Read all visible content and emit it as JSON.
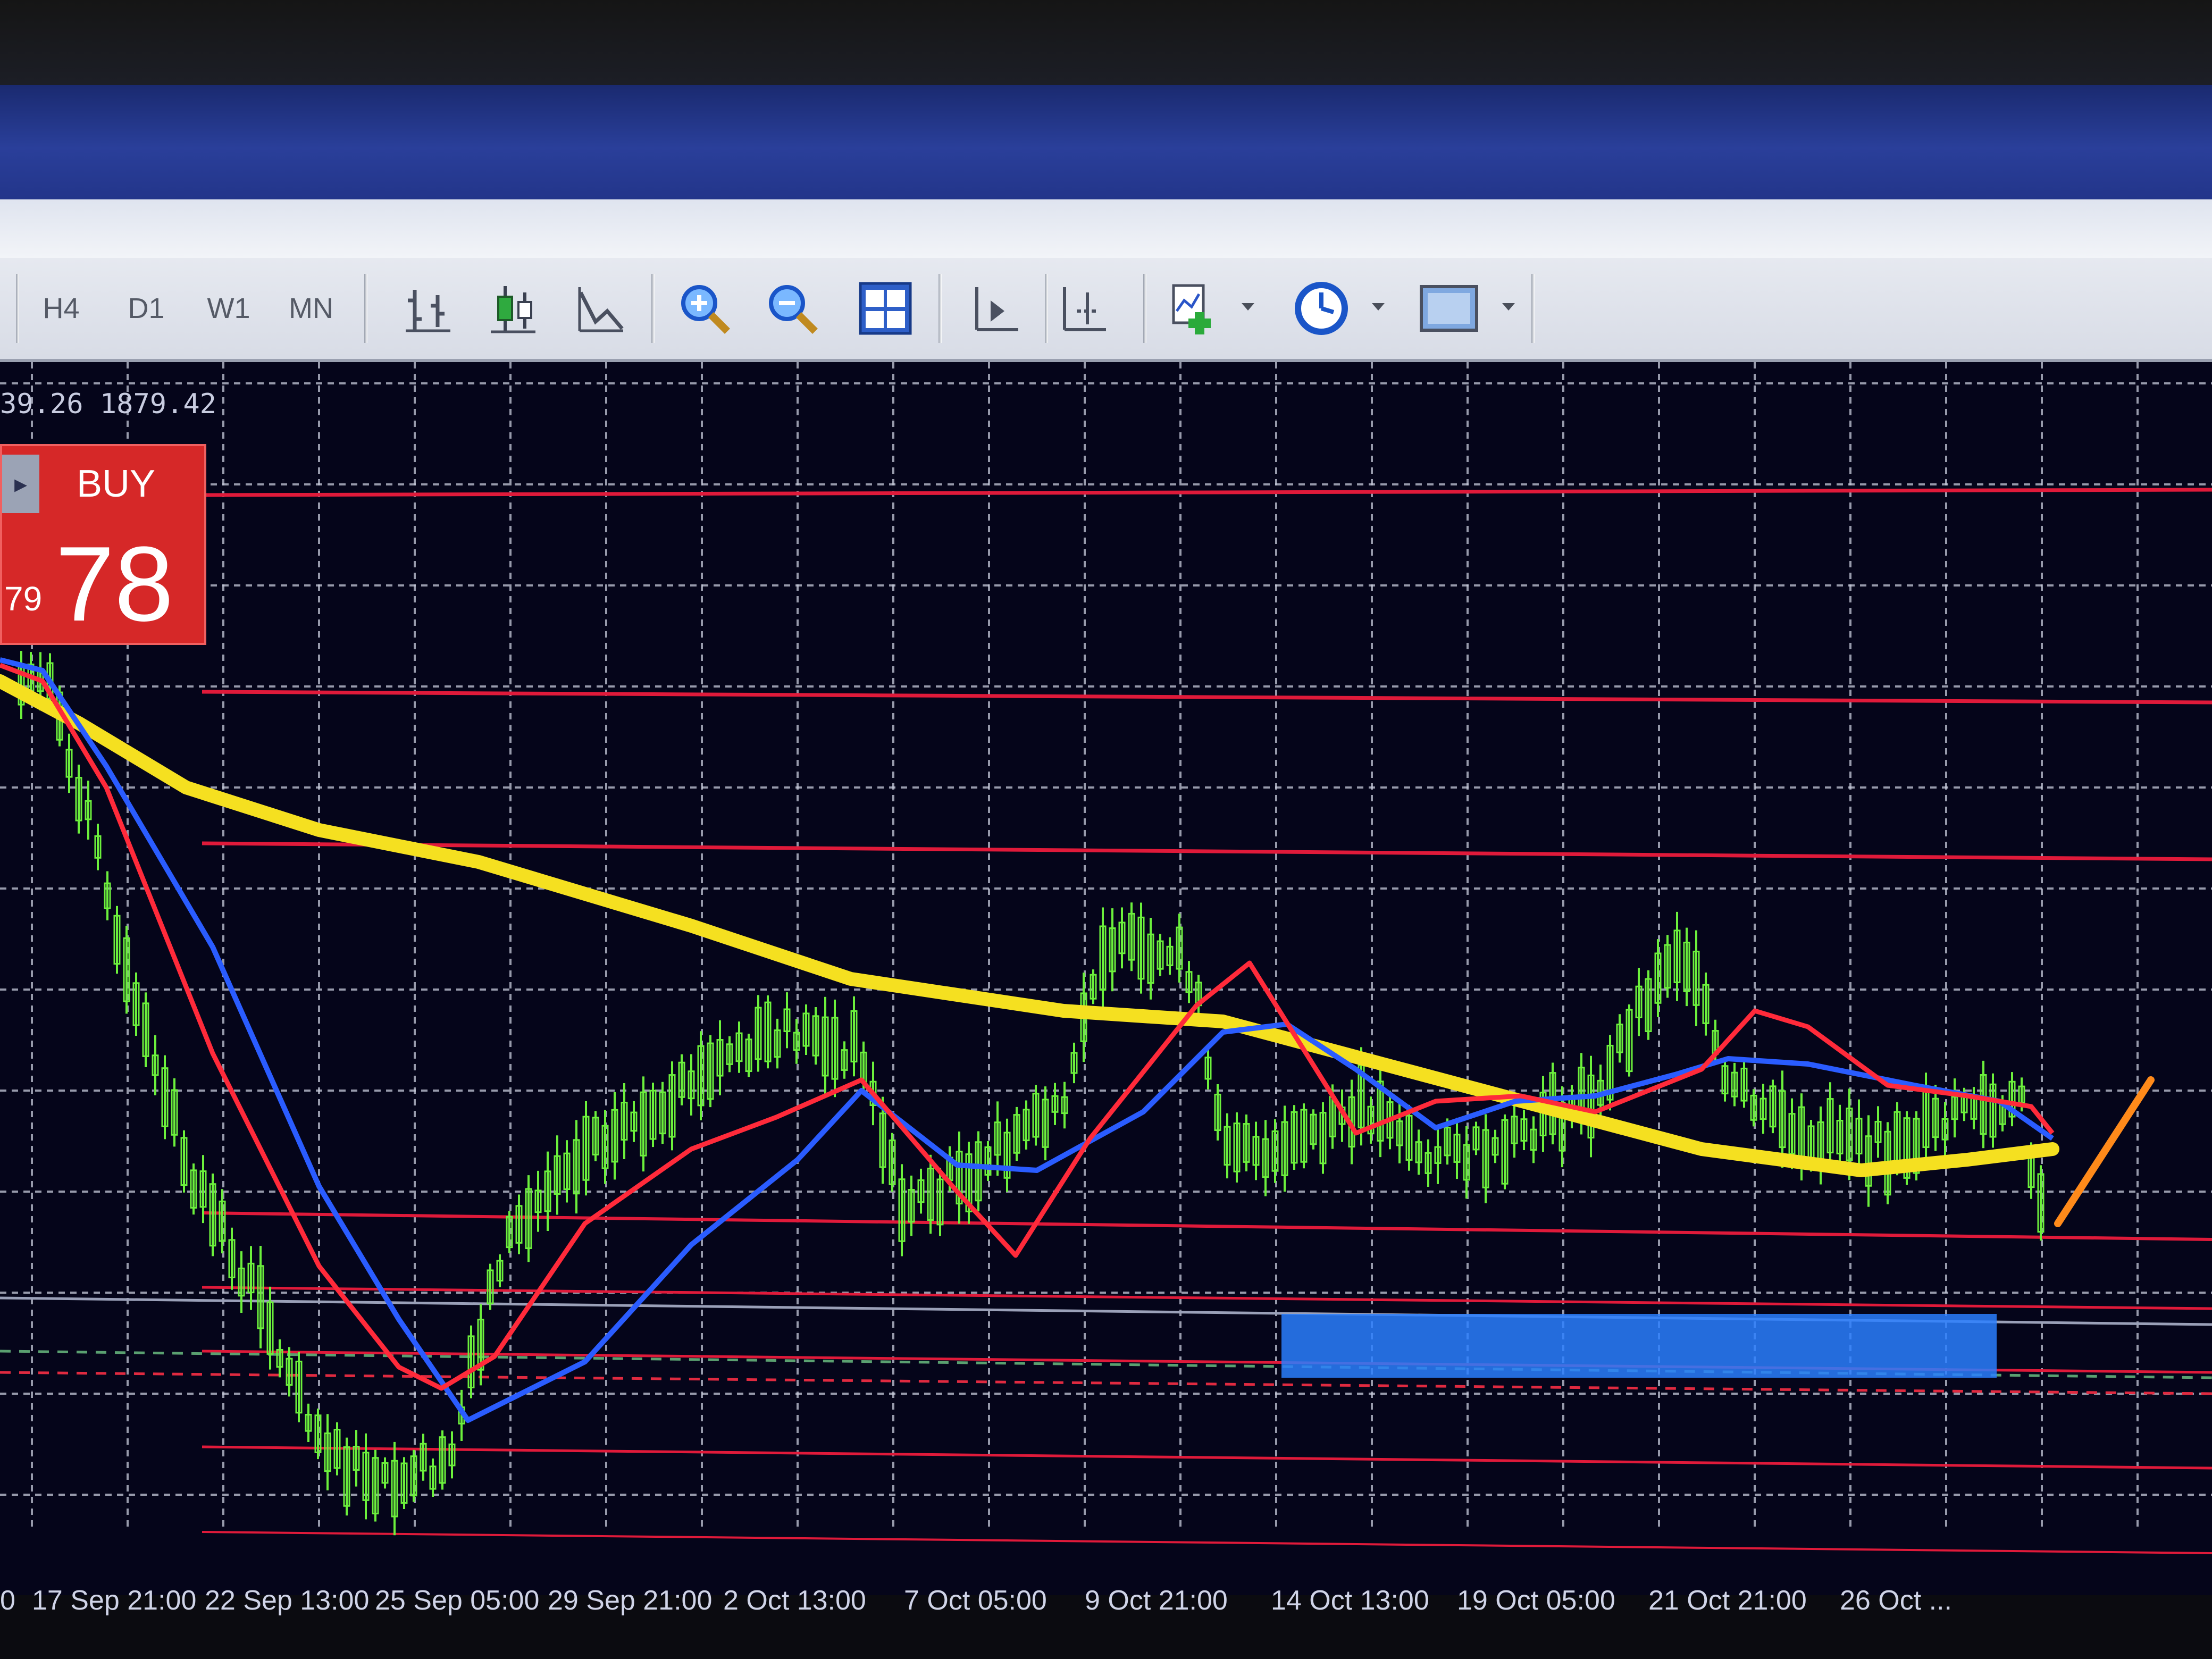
{
  "toolbar": {
    "timeframes": [
      "H4",
      "D1",
      "W1",
      "MN"
    ],
    "icons": [
      "bar-chart-icon",
      "candlestick-icon",
      "line-chart-icon",
      "zoom-in-icon",
      "zoom-out-icon",
      "tile-windows-icon",
      "chart-shift-icon",
      "autoscroll-icon",
      "indicators-icon",
      "periods-icon",
      "templates-icon"
    ]
  },
  "chart": {
    "price_readout": "39.26 1879.42",
    "buy_label": "BUY",
    "buy_price_small": "79",
    "buy_price_big": "78",
    "time_ticks": [
      "0",
      "17 Sep 21:00",
      "22 Sep 13:00",
      "25 Sep 05:00",
      "29 Sep 21:00",
      "2 Oct 13:00",
      "7 Oct 05:00",
      "9 Oct 21:00",
      "14 Oct 13:00",
      "19 Oct 05:00",
      "21 Oct 21:00",
      "26 Oct ..."
    ],
    "colors": {
      "background": "#05051a",
      "grid": "#c8ccdc",
      "candles": "#6cf03c",
      "ma_yellow": "#f5e020",
      "ma_red": "#ff2a3a",
      "ma_blue": "#2a5cff",
      "level_lines": "#e01a3a",
      "zone": "#2a7fff",
      "trend_marker": "#ff8a1a"
    }
  }
}
